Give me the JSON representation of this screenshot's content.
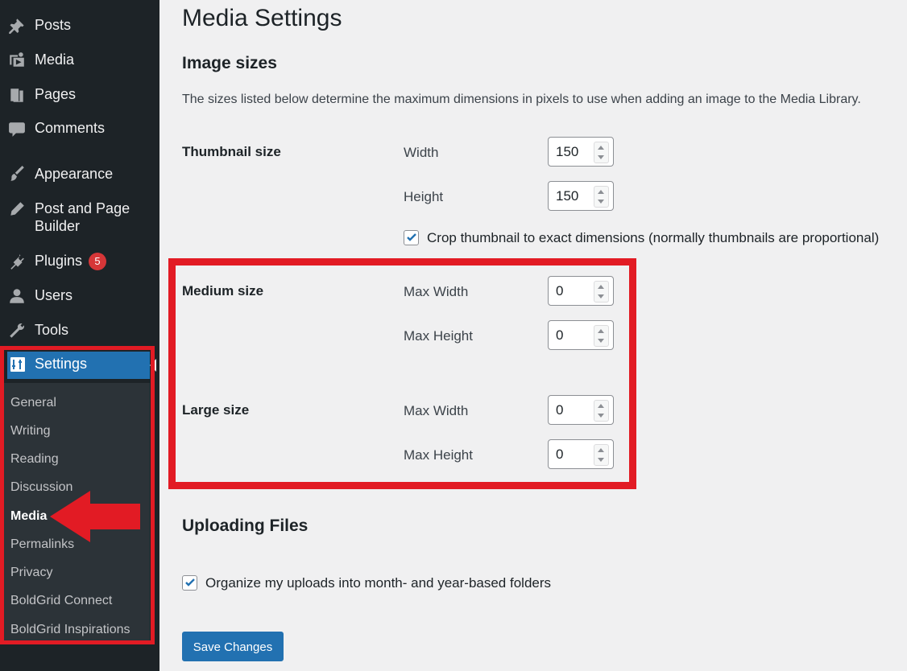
{
  "sidebar": {
    "items": [
      {
        "label": "Posts",
        "icon": "pin-icon"
      },
      {
        "label": "Media",
        "icon": "media-icon"
      },
      {
        "label": "Pages",
        "icon": "pages-icon"
      },
      {
        "label": "Comments",
        "icon": "comment-icon"
      },
      {
        "label": "Appearance",
        "icon": "paintbrush-icon"
      },
      {
        "label": "Post and Page",
        "label2": "Builder",
        "icon": "pencil-icon"
      },
      {
        "label": "Plugins",
        "badge": "5",
        "icon": "plugin-icon"
      },
      {
        "label": "Users",
        "icon": "user-icon"
      },
      {
        "label": "Tools",
        "icon": "wrench-icon"
      }
    ],
    "settings": {
      "label": "Settings",
      "icon": "settings-icon"
    },
    "submenu": [
      "General",
      "Writing",
      "Reading",
      "Discussion",
      "Media",
      "Permalinks",
      "Privacy",
      "BoldGrid Connect",
      "BoldGrid Inspirations"
    ],
    "current_sub": "Media"
  },
  "main": {
    "title": "Media Settings",
    "image_sizes": {
      "heading": "Image sizes",
      "description": "The sizes listed below determine the maximum dimensions in pixels to use when adding an image to the Media Library.",
      "thumbnail": {
        "label": "Thumbnail size",
        "width_label": "Width",
        "width": "150",
        "height_label": "Height",
        "height": "150",
        "crop_label": "Crop thumbnail to exact dimensions (normally thumbnails are proportional)",
        "crop_checked": true
      },
      "medium": {
        "label": "Medium size",
        "width_label": "Max Width",
        "width": "0",
        "height_label": "Max Height",
        "height": "0"
      },
      "large": {
        "label": "Large size",
        "width_label": "Max Width",
        "width": "0",
        "height_label": "Max Height",
        "height": "0"
      }
    },
    "uploading": {
      "heading": "Uploading Files",
      "organize_label": "Organize my uploads into month- and year-based folders",
      "organize_checked": true
    },
    "save_label": "Save Changes"
  },
  "colors": {
    "sidebar_bg": "#1d2327",
    "submenu_bg": "#2c3338",
    "accent": "#2271b1",
    "highlight": "#e21b24",
    "badge": "#d63638",
    "page_bg": "#f0f0f1"
  }
}
